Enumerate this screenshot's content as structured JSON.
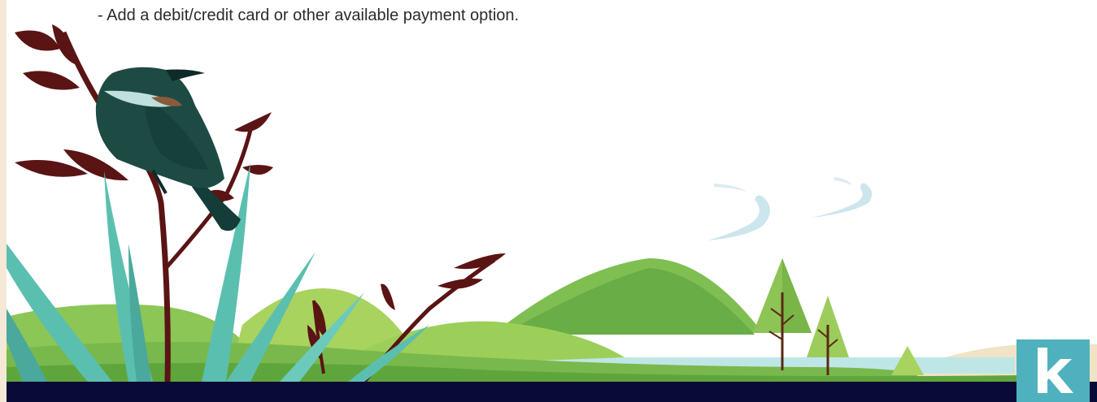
{
  "document": {
    "instruction_text": "- Add a debit/credit card or other available payment option."
  },
  "illustration": {
    "subject": "tui-bird-landscape",
    "colors": {
      "bird": "#1e4a44",
      "flax": "#5bbfb0",
      "branches": "#5a1414",
      "hills_light": "#9ccf5a",
      "hills_dark": "#6cb24a",
      "water": "#bfe6e6",
      "sand": "#f0e3c6",
      "clouds": "#cfe8f0"
    }
  },
  "footer": {
    "bar_color": "#0a0a36",
    "logo_color": "#4fb1bd",
    "logo_icon": "k-logo-icon"
  }
}
